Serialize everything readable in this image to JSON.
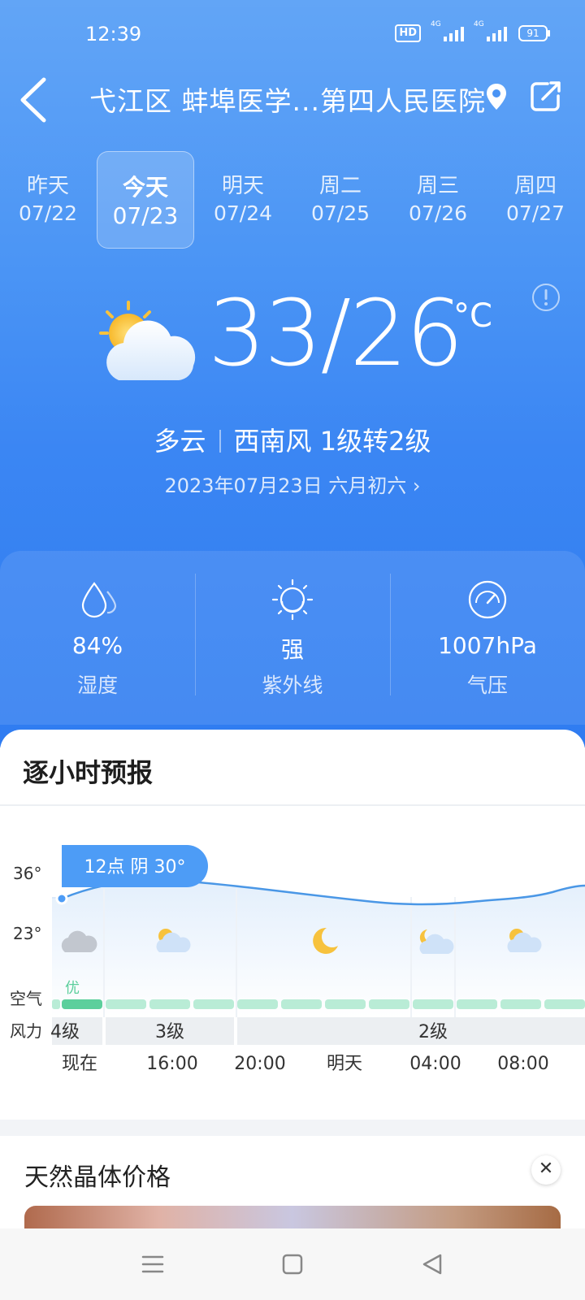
{
  "status_bar": {
    "time": "12:39",
    "hd": "HD",
    "net1": "4G",
    "net2": "4G",
    "battery": "91"
  },
  "header": {
    "location": "弋江区 蚌埠医学...第四人民医院"
  },
  "date_tabs": [
    {
      "day": "昨天",
      "date": "07/22"
    },
    {
      "day": "今天",
      "date": "07/23",
      "selected": true
    },
    {
      "day": "明天",
      "date": "07/24"
    },
    {
      "day": "周二",
      "date": "07/25"
    },
    {
      "day": "周三",
      "date": "07/26"
    },
    {
      "day": "周四",
      "date": "07/27"
    }
  ],
  "current": {
    "temp": "33/26",
    "unit": "°C",
    "condition": "多云",
    "wind": "西南风 1级转2级",
    "date_text": "2023年07月23日 六月初六 ›",
    "weather_icon": "partly-cloudy-icon"
  },
  "metrics": [
    {
      "value": "84%",
      "label": "湿度",
      "icon": "humidity-icon"
    },
    {
      "value": "强",
      "label": "紫外线",
      "icon": "uv-sun-icon"
    },
    {
      "value": "1007hPa",
      "label": "气压",
      "icon": "pressure-gauge-icon"
    }
  ],
  "hourly": {
    "title": "逐小时预报",
    "tooltip": "12点 阴 30°",
    "y_labels": [
      "36°",
      "23°"
    ],
    "air_label": "空气",
    "air_quality": "优",
    "wind_label": "风力",
    "wind_segments": [
      "4级",
      "3级",
      "2级"
    ],
    "time_labels": [
      "现在",
      "16:00",
      "20:00",
      "明天",
      "04:00",
      "08:00"
    ],
    "icons": [
      "cloudy-icon",
      "partly-cloudy-icon",
      "moon-icon",
      "moon-cloud-icon",
      "partly-cloudy-icon"
    ],
    "colors": {
      "line": "#4a97e6",
      "air_good": "#5ccf9c",
      "air_light": "#b9ecd6",
      "tooltip": "#4d9cf6"
    }
  },
  "ad": {
    "title": "天然晶体价格",
    "close": "✕"
  }
}
